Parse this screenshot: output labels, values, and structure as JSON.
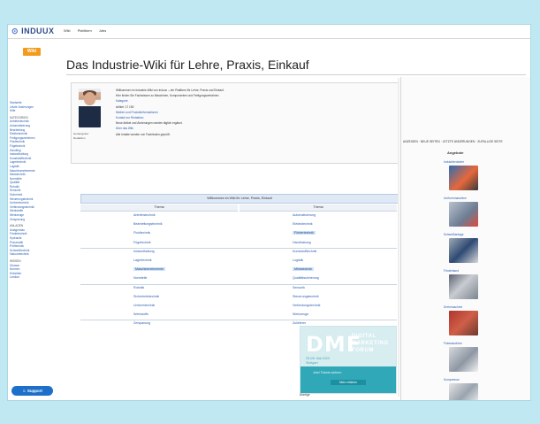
{
  "brand": {
    "logo_text": "INDUUX",
    "logo_sub": "",
    "wiki_badge": "Wiki"
  },
  "topnav": [
    "Wiki",
    "Plattform",
    "Jobs"
  ],
  "page": {
    "title": "Das Industrie-Wiki für Lehre, Praxis, Einkauf"
  },
  "sidebar": {
    "items": [
      "Startseite",
      "Letzte Änderungen",
      "Hilfe",
      "KATEGORIEN",
      "Antriebstechnik",
      "Automatisierung",
      "Bearbeitung",
      "Elektrotechnik",
      "Fertigungsverfahren",
      "Fluidtechnik",
      "Fügetechnik",
      "Handling",
      "Instandhaltung",
      "Kunststofftechnik",
      "Lagertechnik",
      "Logistik",
      "Maschinenelemente",
      "Messtechnik",
      "Normteile",
      "Qualität",
      "Robotik",
      "Sensorik",
      "Sicherheit",
      "Steuerungstechnik",
      "Umformtechnik",
      "Verbindungstechnik",
      "Werkstoffe",
      "Werkzeuge",
      "Zerspanung",
      "ANLAGEN",
      "Anlagenbau",
      "Fördertechnik",
      "Hydraulik",
      "Pneumatik",
      "Prüftechnik",
      "Schweißtechnik",
      "Vakuumtechnik",
      "WISSEN",
      "Glossar",
      "Normen",
      "Einheiten",
      "Lexikon"
    ],
    "support_label": "Support"
  },
  "intro": {
    "caption_lines": [
      "Herausgeber",
      "Redaktion"
    ],
    "lines": [
      "Willkommen im Industrie-Wiki von induux – der Plattform für Lehre, Praxis und Einkauf.",
      "Hier finden Sie Fachwissen zu Maschinen, Komponenten und Fertigungsverfahren.",
      "Kategorie",
      "Artikel: 17 150",
      "Medien und Produktinformationen",
      "Kontakt zur Redaktion",
      "Neue Artikel und Änderungen werden täglich ergänzt.",
      "Über das Wiki",
      "Alle Inhalte werden von Fachleuten geprüft."
    ]
  },
  "table": {
    "header": "Willkommen im Wiki für Lehre, Praxis, Einkauf",
    "col_left": "Thema",
    "col_right": "Thema",
    "rows": [
      [
        "Antriebstechnik",
        "Automatisierung"
      ],
      [
        "Bearbeitungstechnik",
        "Elektrotechnik"
      ],
      [
        "Fluidtechnik",
        "Fördertechnik"
      ],
      [
        "Fügetechnik",
        "Handhabung"
      ],
      [
        "Instandhaltung",
        "Kunststofftechnik"
      ],
      [
        "Lagertechnik",
        "Logistik"
      ],
      [
        "Maschinenelemente",
        "Messtechnik"
      ],
      [
        "Normteile",
        "Qualitätssicherung"
      ],
      [
        "Robotik",
        "Sensorik"
      ],
      [
        "Sicherheitstechnik",
        "Steuerungstechnik"
      ],
      [
        "Umformtechnik",
        "Verbindungstechnik"
      ],
      [
        "Werkstoffe",
        "Werkzeuge"
      ],
      [
        "Zerspanung",
        "Zulieferer"
      ]
    ],
    "highlighted": [
      "Fördertechnik",
      "Maschinenelemente",
      "Messtechnik"
    ]
  },
  "right_column": {
    "links": "ANZEIGEN  ·  NEUE SEITEN  ·  LETZTE ÄNDERUNGEN  ·  ZUFÄLLIGE SEITE",
    "heading": "Angebote",
    "cards": [
      "Industrieroboter",
      "Umformmaschine",
      "Schweißanlage",
      "Förderband",
      "Drehmaschine",
      "Fräsmaschine",
      "Kompressor",
      "Zahnrad"
    ]
  },
  "ad": {
    "big": "DMF",
    "words": [
      "DIGITAL",
      "MARKETING",
      "FORUM"
    ],
    "date_lines": [
      "25./26. Mai 2023",
      "Stuttgart"
    ],
    "band_text": "Jetzt Tickets sichern",
    "button": "Mehr erfahren",
    "caption": "Anzeige"
  },
  "colors": {
    "background": "#bfe8f2",
    "accent_orange": "#f29b1d",
    "link_blue": "#2a5db0",
    "support_blue": "#1d70c9",
    "ad_teal": "#31a8b7"
  }
}
